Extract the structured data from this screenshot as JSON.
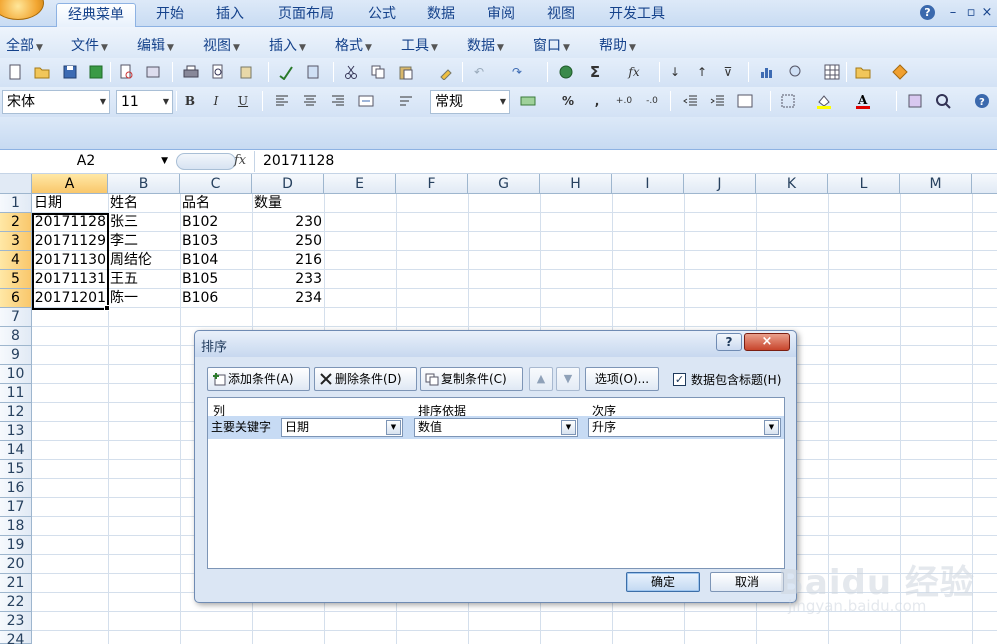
{
  "ribbon_tabs": [
    "经典菜单",
    "开始",
    "插入",
    "页面布局",
    "公式",
    "数据",
    "审阅",
    "视图",
    "开发工具"
  ],
  "active_tab": "经典菜单",
  "window_controls": {
    "help": "?",
    "minimize": "–",
    "restore": "▫",
    "close": "×"
  },
  "classic_menu": [
    "全部",
    "文件",
    "编辑",
    "视图",
    "插入",
    "格式",
    "工具",
    "数据",
    "窗口",
    "帮助"
  ],
  "font_box": {
    "name": "宋体",
    "size": "11"
  },
  "format_buttons": {
    "bold": "B",
    "italic": "I",
    "underline": "U"
  },
  "number_format": "常规",
  "number_buttons": {
    "percent": "%",
    "comma": ",",
    "inc_decimal": "+.0",
    "dec_decimal": "-.0"
  },
  "formula_bar": {
    "name_box": "A2",
    "fx": "fx",
    "value": "20171128"
  },
  "columns": [
    "A",
    "B",
    "C",
    "D",
    "E",
    "F",
    "G",
    "H",
    "I",
    "J",
    "K",
    "L",
    "M"
  ],
  "rows": [
    "1",
    "2",
    "3",
    "4",
    "5",
    "6",
    "7",
    "8",
    "9",
    "10",
    "11",
    "12",
    "13",
    "14",
    "15",
    "16",
    "17",
    "18",
    "19",
    "20",
    "21",
    "22",
    "23",
    "24"
  ],
  "cells": {
    "header": [
      "日期",
      "姓名",
      "品名",
      "数量"
    ],
    "data": [
      [
        "20171128",
        "张三",
        "B102",
        "230"
      ],
      [
        "20171129",
        "李二",
        "B103",
        "250"
      ],
      [
        "20171130",
        "周结伦",
        "B104",
        "216"
      ],
      [
        "20171131",
        "王五",
        "B105",
        "233"
      ],
      [
        "20171201",
        "陈一",
        "B106",
        "234"
      ]
    ]
  },
  "sort_dialog": {
    "title": "排序",
    "help": "?",
    "close": "×",
    "add_level": "添加条件(A)",
    "delete_level": "删除条件(D)",
    "copy_level": "复制条件(C)",
    "move_up": "▲",
    "move_down": "▼",
    "options": "选项(O)...",
    "has_headers_label": "数据包含标题(H)",
    "has_headers_checked": "✓",
    "headers": {
      "column": "列",
      "sort_on": "排序依据",
      "order": "次序"
    },
    "level": {
      "label": "主要关键字",
      "column": "日期",
      "sort_on": "数值",
      "order": "升序"
    },
    "ok": "确定",
    "cancel": "取消"
  },
  "watermark": {
    "logo": "Baidu 经验",
    "url": "jingyan.baidu.com"
  }
}
